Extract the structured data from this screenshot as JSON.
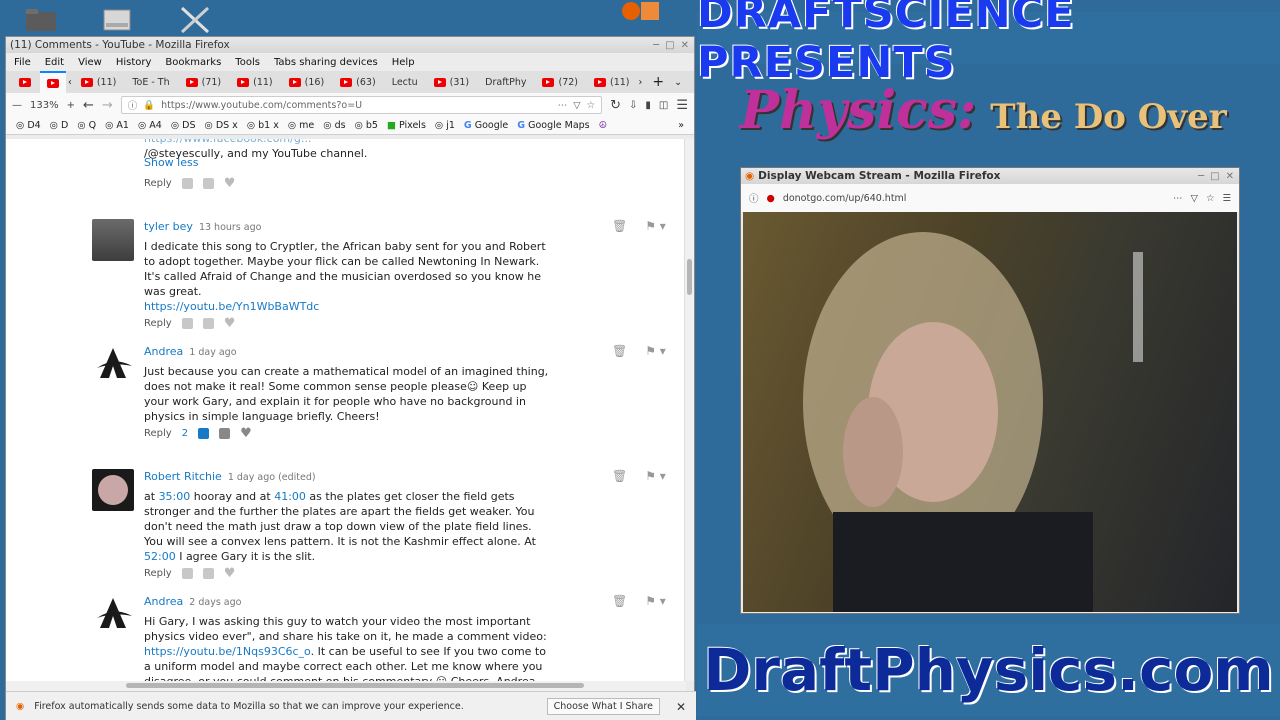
{
  "desktop": {
    "icons": [
      "folder-icon",
      "drive-icon",
      "tools-icon"
    ]
  },
  "firefox": {
    "window_title": "(11) Comments - YouTube - Mozilla Firefox",
    "menu": [
      "File",
      "Edit",
      "View",
      "History",
      "Bookmarks",
      "Tools",
      "Tabs sharing devices",
      "Help"
    ],
    "tabs": [
      "(11)",
      "ToE - Th",
      "(71)",
      "(11)",
      "(16)",
      "(63)",
      "Lectu",
      "(31)",
      "DraftPhy",
      "(72)",
      "(11)"
    ],
    "zoom": "133%",
    "url": "https://www.youtube.com/comments?o=U",
    "bookmarks": [
      "D4",
      "D",
      "Q",
      "A1",
      "A4",
      "DS",
      "DS x",
      "b1 x",
      "me",
      "ds",
      "b5",
      "Pixels",
      "j1",
      "Google",
      "Google Maps"
    ],
    "notification": "Firefox automatically sends some data to Mozilla so that we can improve your experience.",
    "notification_button": "Choose What I Share"
  },
  "comments": {
    "top_partial": {
      "line1": "/@steyescully, and my YouTube channel.",
      "show_less": "Show less",
      "reply": "Reply"
    },
    "items": [
      {
        "author": "tyler bey",
        "time": "13 hours ago",
        "text": "I dedicate this song to Cryptler, the African baby sent for you and Robert to adopt together. Maybe your flick can be called Newtoning In Newark. It's called Afraid of Change and the musician overdosed so you know he was great.",
        "link": "https://youtu.be/Yn1WbBaWTdc",
        "reply": "Reply",
        "likes": ""
      },
      {
        "author": "Andrea",
        "time": "1 day ago",
        "text": "Just because you can create a mathematical model of an imagined thing, does not make it real! Some common sense people please☺ Keep up your work Gary, and explain it for people who have no background in physics in simple language briefly. Cheers!",
        "reply": "Reply",
        "likes": "2"
      },
      {
        "author": "Robert Ritchie",
        "time": "1 day ago (edited)",
        "text_pre": "at ",
        "ts1": "35:00",
        "text_mid1": " hooray and at ",
        "ts2": "41:00",
        "text_mid2": " as the plates get closer the field gets stronger and the further the plates are apart the fields get weaker. You don't need the math just draw a top down view of the plate field lines. You will see a convex lens pattern.  It is not the Kashmir effect alone.  At ",
        "ts3": "52:00",
        "text_post": " I agree Gary it is the slit.",
        "reply": "Reply",
        "likes": ""
      },
      {
        "author": "Andrea",
        "time": "2 days ago",
        "text_pre": "Hi Gary, I was asking this guy to watch your video the most important physics video ever\", and share his take on it, he made a comment video: ",
        "link": "https://youtu.be/1Nqs93C6c_o",
        "text_post": ". It can be useful to see If you two come to a uniform model and maybe correct each other. Let me know where you disagree, or you could comment on his commentary ☺ Cheers, Andrea",
        "reply": "Reply"
      }
    ]
  },
  "overlay": {
    "banner_top": "DRAFTSCIENCE PRESENTS",
    "physics": "Physics:",
    "do_over": "The Do Over",
    "banner_bottom": "DraftPhysics.com"
  },
  "webcam_window": {
    "title": "Display Webcam Stream - Mozilla Firefox",
    "url": "donotgo.com/up/640.html"
  }
}
